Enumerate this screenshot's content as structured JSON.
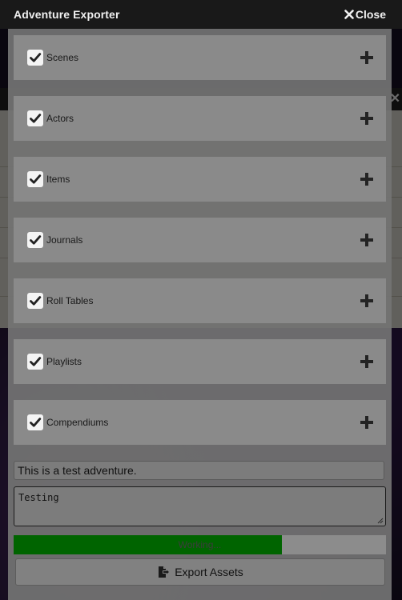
{
  "dialog": {
    "title": "Adventure Exporter",
    "close_label": "Close"
  },
  "sections": [
    {
      "label": "Scenes",
      "checked": true
    },
    {
      "label": "Actors",
      "checked": true
    },
    {
      "label": "Items",
      "checked": true
    },
    {
      "label": "Journals",
      "checked": true
    },
    {
      "label": "Roll Tables",
      "checked": true
    },
    {
      "label": "Playlists",
      "checked": true
    },
    {
      "label": "Compendiums",
      "checked": true
    }
  ],
  "adventure_name": {
    "value": "This is a test adventure."
  },
  "adventure_description": {
    "value": "Testing"
  },
  "progress": {
    "label": "Working...",
    "percent": 72
  },
  "export_button": {
    "label": "Export Assets"
  },
  "colors": {
    "progress_fill": "#006400",
    "titlebar": "#191919",
    "section_bg": "#8a8a8a"
  },
  "icons": {
    "close": "times-icon",
    "checkbox": "checkmark-icon",
    "expand": "plus-icon",
    "export": "file-export-icon"
  }
}
